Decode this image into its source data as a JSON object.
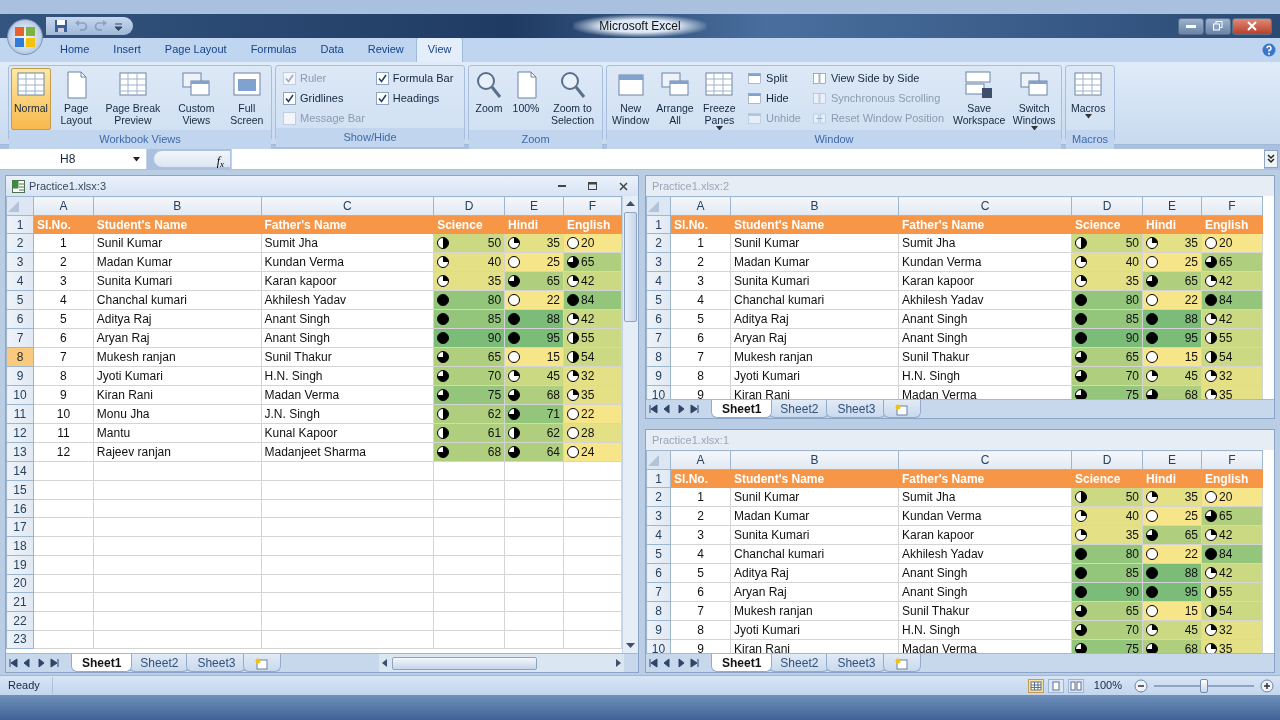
{
  "window": {
    "title": "Microsoft Excel"
  },
  "quick_access": [
    {
      "kind": "save",
      "disabled": false
    },
    {
      "kind": "undo",
      "disabled": true
    },
    {
      "kind": "redo",
      "disabled": true
    },
    {
      "kind": "customize",
      "disabled": false
    }
  ],
  "ribbon_tabs": [
    {
      "label": "Home",
      "selected": false
    },
    {
      "label": "Insert",
      "selected": false
    },
    {
      "label": "Page Layout",
      "selected": false
    },
    {
      "label": "Formulas",
      "selected": false
    },
    {
      "label": "Data",
      "selected": false
    },
    {
      "label": "Review",
      "selected": false
    },
    {
      "label": "View",
      "selected": true
    }
  ],
  "ribbon_groups": [
    {
      "label": "Workbook Views",
      "items": [
        {
          "kind": "large",
          "label": "Normal",
          "selected": true
        },
        {
          "kind": "large",
          "label": "Page Layout",
          "selected": false
        },
        {
          "kind": "large",
          "label": "Page Break Preview",
          "selected": false
        },
        {
          "kind": "large",
          "label": "Custom Views",
          "selected": false
        },
        {
          "kind": "large",
          "label": "Full Screen",
          "selected": false
        }
      ]
    },
    {
      "label": "Show/Hide",
      "items": [
        {
          "kind": "check",
          "label": "Ruler",
          "checked": true,
          "disabled": true
        },
        {
          "kind": "check",
          "label": "Gridlines",
          "checked": true,
          "disabled": false
        },
        {
          "kind": "check",
          "label": "Message Bar",
          "checked": false,
          "disabled": true
        },
        {
          "kind": "check",
          "label": "Formula Bar",
          "checked": true,
          "disabled": false
        },
        {
          "kind": "check",
          "label": "Headings",
          "checked": true,
          "disabled": false
        }
      ]
    },
    {
      "label": "Zoom",
      "items": [
        {
          "kind": "large",
          "label": "Zoom"
        },
        {
          "kind": "large",
          "label": "100%"
        },
        {
          "kind": "large",
          "label": "Zoom to Selection"
        }
      ]
    },
    {
      "label": "Window",
      "items": [
        {
          "kind": "large",
          "label": "New Window"
        },
        {
          "kind": "large",
          "label": "Arrange All"
        },
        {
          "kind": "large",
          "label": "Freeze Panes",
          "dropdown": true
        },
        {
          "kind": "small",
          "label": "Split",
          "disabled": false
        },
        {
          "kind": "small",
          "label": "Hide",
          "disabled": false
        },
        {
          "kind": "small",
          "label": "Unhide",
          "disabled": true
        },
        {
          "kind": "small",
          "label": "View Side by Side",
          "disabled": false
        },
        {
          "kind": "small",
          "label": "Synchronous Scrolling",
          "disabled": true
        },
        {
          "kind": "small",
          "label": "Reset Window Position",
          "disabled": true
        },
        {
          "kind": "large",
          "label": "Save Workspace"
        },
        {
          "kind": "large",
          "label": "Switch Windows",
          "dropdown": true
        }
      ]
    },
    {
      "label": "Macros",
      "items": [
        {
          "kind": "large",
          "label": "Macros",
          "dropdown": true
        }
      ]
    }
  ],
  "formula_bar": {
    "name_box": "H8",
    "function_button": "f$_{x}$"
  },
  "workbooks": [
    {
      "title": "Practice1.xlsx:3",
      "active": true,
      "columns": [
        "A",
        "B",
        "C",
        "D",
        "E",
        "F"
      ],
      "header": {
        "row": "1",
        "cells": [
          "Sl.No.",
          "Student's Name",
          "Father's Name",
          "Science",
          "Hindi",
          "English"
        ]
      },
      "rows": [
        {
          "row": "2",
          "selected": false,
          "cells": [
            "1",
            "Sunil Kumar",
            "Sumit Jha"
          ],
          "scores": [
            {
              "value": "50",
              "kind": "half",
              "color": "#cbd982"
            },
            {
              "value": "35",
              "kind": "quarter",
              "color": "#e3e086"
            },
            {
              "value": "20",
              "kind": "empty",
              "color": "#f7e589"
            }
          ]
        },
        {
          "row": "3",
          "selected": false,
          "cells": [
            "2",
            "Madan Kumar",
            "Kundan Verma"
          ],
          "scores": [
            {
              "value": "40",
              "kind": "quarter",
              "color": "#e3e086"
            },
            {
              "value": "25",
              "kind": "empty",
              "color": "#f7e589"
            },
            {
              "value": "65",
              "kind": "threequarters",
              "color": "#b0cf7e"
            }
          ]
        },
        {
          "row": "4",
          "selected": false,
          "cells": [
            "3",
            "Sunita Kumari",
            "Karan kapoor"
          ],
          "scores": [
            {
              "value": "35",
              "kind": "quarter",
              "color": "#e3e086"
            },
            {
              "value": "65",
              "kind": "threequarters",
              "color": "#b0cf7e"
            },
            {
              "value": "42",
              "kind": "quarter",
              "color": "#cbd982"
            }
          ]
        },
        {
          "row": "5",
          "selected": false,
          "cells": [
            "4",
            "Chanchal kumari",
            "Akhilesh Yadav"
          ],
          "scores": [
            {
              "value": "80",
              "kind": "full",
              "color": "#93c57b"
            },
            {
              "value": "22",
              "kind": "empty",
              "color": "#f7e589"
            },
            {
              "value": "84",
              "kind": "full",
              "color": "#93c57b"
            }
          ]
        },
        {
          "row": "6",
          "selected": false,
          "cells": [
            "5",
            "Aditya Raj",
            "Anant Singh"
          ],
          "scores": [
            {
              "value": "85",
              "kind": "full",
              "color": "#93c57b"
            },
            {
              "value": "88",
              "kind": "full",
              "color": "#7bbd78"
            },
            {
              "value": "42",
              "kind": "quarter",
              "color": "#cbd982"
            }
          ]
        },
        {
          "row": "7",
          "selected": false,
          "cells": [
            "6",
            "Aryan Raj",
            "Anant Singh"
          ],
          "scores": [
            {
              "value": "90",
              "kind": "full",
              "color": "#7bbd78"
            },
            {
              "value": "95",
              "kind": "full",
              "color": "#7bbd78"
            },
            {
              "value": "55",
              "kind": "half",
              "color": "#cbd982"
            }
          ]
        },
        {
          "row": "8",
          "selected": true,
          "cells": [
            "7",
            "Mukesh ranjan",
            "Sunil Thakur"
          ],
          "scores": [
            {
              "value": "65",
              "kind": "threequarters",
              "color": "#b0cf7e"
            },
            {
              "value": "15",
              "kind": "empty",
              "color": "#f7e589"
            },
            {
              "value": "54",
              "kind": "half",
              "color": "#cbd982"
            }
          ]
        },
        {
          "row": "9",
          "selected": false,
          "cells": [
            "8",
            "Jyoti Kumari",
            "H.N. Singh"
          ],
          "scores": [
            {
              "value": "70",
              "kind": "threequarters",
              "color": "#b0cf7e"
            },
            {
              "value": "45",
              "kind": "quarter",
              "color": "#cbd982"
            },
            {
              "value": "32",
              "kind": "quarter",
              "color": "#e3e086"
            }
          ]
        },
        {
          "row": "10",
          "selected": false,
          "cells": [
            "9",
            "Kiran Rani",
            "Madan Verma"
          ],
          "scores": [
            {
              "value": "75",
              "kind": "threequarters",
              "color": "#93c57b"
            },
            {
              "value": "68",
              "kind": "threequarters",
              "color": "#b0cf7e"
            },
            {
              "value": "35",
              "kind": "quarter",
              "color": "#e3e086"
            }
          ]
        },
        {
          "row": "11",
          "selected": false,
          "cells": [
            "10",
            "Monu Jha",
            "J.N. Singh"
          ],
          "scores": [
            {
              "value": "62",
              "kind": "half",
              "color": "#b0cf7e"
            },
            {
              "value": "71",
              "kind": "threequarters",
              "color": "#93c57b"
            },
            {
              "value": "22",
              "kind": "empty",
              "color": "#f7e589"
            }
          ]
        },
        {
          "row": "12",
          "selected": false,
          "cells": [
            "11",
            "Mantu",
            "Kunal Kapoor"
          ],
          "scores": [
            {
              "value": "61",
              "kind": "half",
              "color": "#b0cf7e"
            },
            {
              "value": "62",
              "kind": "half",
              "color": "#b0cf7e"
            },
            {
              "value": "28",
              "kind": "empty",
              "color": "#e3e086"
            }
          ]
        },
        {
          "row": "13",
          "selected": false,
          "cells": [
            "12",
            "Rajeev ranjan",
            "Madanjeet Sharma"
          ],
          "scores": [
            {
              "value": "68",
              "kind": "threequarters",
              "color": "#b0cf7e"
            },
            {
              "value": "64",
              "kind": "threequarters",
              "color": "#b0cf7e"
            },
            {
              "value": "24",
              "kind": "empty",
              "color": "#f7e589"
            }
          ]
        }
      ],
      "empty_rows": [
        "14",
        "15",
        "16",
        "17",
        "18",
        "19",
        "20",
        "21",
        "22",
        "23"
      ],
      "sheets": [
        {
          "label": "Sheet1",
          "selected": true
        },
        {
          "label": "Sheet2",
          "selected": false
        },
        {
          "label": "Sheet3",
          "selected": false
        }
      ]
    },
    {
      "title": "Practice1.xlsx:2",
      "active": false,
      "columns": [
        "A",
        "B",
        "C",
        "D",
        "E",
        "F"
      ],
      "header": {
        "row": "1",
        "cells": [
          "Sl.No.",
          "Student's Name",
          "Father's Name",
          "Science",
          "Hindi",
          "English"
        ]
      },
      "rows": [
        {
          "row": "2",
          "selected": false,
          "cells": [
            "1",
            "Sunil Kumar",
            "Sumit Jha"
          ],
          "scores": [
            {
              "value": "50",
              "kind": "half",
              "color": "#cbd982"
            },
            {
              "value": "35",
              "kind": "quarter",
              "color": "#e3e086"
            },
            {
              "value": "20",
              "kind": "empty",
              "color": "#f7e589"
            }
          ]
        },
        {
          "row": "3",
          "selected": false,
          "cells": [
            "2",
            "Madan Kumar",
            "Kundan Verma"
          ],
          "scores": [
            {
              "value": "40",
              "kind": "quarter",
              "color": "#e3e086"
            },
            {
              "value": "25",
              "kind": "empty",
              "color": "#f7e589"
            },
            {
              "value": "65",
              "kind": "threequarters",
              "color": "#b0cf7e"
            }
          ]
        },
        {
          "row": "4",
          "selected": false,
          "cells": [
            "3",
            "Sunita Kumari",
            "Karan kapoor"
          ],
          "scores": [
            {
              "value": "35",
              "kind": "quarter",
              "color": "#e3e086"
            },
            {
              "value": "65",
              "kind": "threequarters",
              "color": "#b0cf7e"
            },
            {
              "value": "42",
              "kind": "quarter",
              "color": "#cbd982"
            }
          ]
        },
        {
          "row": "5",
          "selected": false,
          "cells": [
            "4",
            "Chanchal kumari",
            "Akhilesh Yadav"
          ],
          "scores": [
            {
              "value": "80",
              "kind": "full",
              "color": "#93c57b"
            },
            {
              "value": "22",
              "kind": "empty",
              "color": "#f7e589"
            },
            {
              "value": "84",
              "kind": "full",
              "color": "#93c57b"
            }
          ]
        },
        {
          "row": "6",
          "selected": false,
          "cells": [
            "5",
            "Aditya Raj",
            "Anant Singh"
          ],
          "scores": [
            {
              "value": "85",
              "kind": "full",
              "color": "#93c57b"
            },
            {
              "value": "88",
              "kind": "full",
              "color": "#7bbd78"
            },
            {
              "value": "42",
              "kind": "quarter",
              "color": "#cbd982"
            }
          ]
        },
        {
          "row": "7",
          "selected": false,
          "cells": [
            "6",
            "Aryan Raj",
            "Anant Singh"
          ],
          "scores": [
            {
              "value": "90",
              "kind": "full",
              "color": "#7bbd78"
            },
            {
              "value": "95",
              "kind": "full",
              "color": "#7bbd78"
            },
            {
              "value": "55",
              "kind": "half",
              "color": "#cbd982"
            }
          ]
        },
        {
          "row": "8",
          "selected": false,
          "cells": [
            "7",
            "Mukesh ranjan",
            "Sunil Thakur"
          ],
          "scores": [
            {
              "value": "65",
              "kind": "threequarters",
              "color": "#b0cf7e"
            },
            {
              "value": "15",
              "kind": "empty",
              "color": "#f7e589"
            },
            {
              "value": "54",
              "kind": "half",
              "color": "#cbd982"
            }
          ]
        },
        {
          "row": "9",
          "selected": false,
          "cells": [
            "8",
            "Jyoti Kumari",
            "H.N. Singh"
          ],
          "scores": [
            {
              "value": "70",
              "kind": "threequarters",
              "color": "#b0cf7e"
            },
            {
              "value": "45",
              "kind": "quarter",
              "color": "#cbd982"
            },
            {
              "value": "32",
              "kind": "quarter",
              "color": "#e3e086"
            }
          ]
        },
        {
          "row": "10",
          "selected": false,
          "cells": [
            "9",
            "Kiran Rani",
            "Madan Verma"
          ],
          "scores": [
            {
              "value": "75",
              "kind": "threequarters",
              "color": "#93c57b"
            },
            {
              "value": "68",
              "kind": "threequarters",
              "color": "#b0cf7e"
            },
            {
              "value": "35",
              "kind": "quarter",
              "color": "#e3e086"
            }
          ]
        }
      ],
      "sheets": [
        {
          "label": "Sheet1",
          "selected": true
        },
        {
          "label": "Sheet2",
          "selected": false
        },
        {
          "label": "Sheet3",
          "selected": false
        }
      ]
    },
    {
      "title": "Practice1.xlsx:1",
      "active": false,
      "columns": [
        "A",
        "B",
        "C",
        "D",
        "E",
        "F"
      ],
      "header": {
        "row": "1",
        "cells": [
          "Sl.No.",
          "Student's Name",
          "Father's Name",
          "Science",
          "Hindi",
          "English"
        ]
      },
      "rows": [
        {
          "row": "2",
          "selected": false,
          "cells": [
            "1",
            "Sunil Kumar",
            "Sumit Jha"
          ],
          "scores": [
            {
              "value": "50",
              "kind": "half",
              "color": "#cbd982"
            },
            {
              "value": "35",
              "kind": "quarter",
              "color": "#e3e086"
            },
            {
              "value": "20",
              "kind": "empty",
              "color": "#f7e589"
            }
          ]
        },
        {
          "row": "3",
          "selected": false,
          "cells": [
            "2",
            "Madan Kumar",
            "Kundan Verma"
          ],
          "scores": [
            {
              "value": "40",
              "kind": "quarter",
              "color": "#e3e086"
            },
            {
              "value": "25",
              "kind": "empty",
              "color": "#f7e589"
            },
            {
              "value": "65",
              "kind": "threequarters",
              "color": "#b0cf7e"
            }
          ]
        },
        {
          "row": "4",
          "selected": false,
          "cells": [
            "3",
            "Sunita Kumari",
            "Karan kapoor"
          ],
          "scores": [
            {
              "value": "35",
              "kind": "quarter",
              "color": "#e3e086"
            },
            {
              "value": "65",
              "kind": "threequarters",
              "color": "#b0cf7e"
            },
            {
              "value": "42",
              "kind": "quarter",
              "color": "#cbd982"
            }
          ]
        },
        {
          "row": "5",
          "selected": false,
          "cells": [
            "4",
            "Chanchal kumari",
            "Akhilesh Yadav"
          ],
          "scores": [
            {
              "value": "80",
              "kind": "full",
              "color": "#93c57b"
            },
            {
              "value": "22",
              "kind": "empty",
              "color": "#f7e589"
            },
            {
              "value": "84",
              "kind": "full",
              "color": "#93c57b"
            }
          ]
        },
        {
          "row": "6",
          "selected": false,
          "cells": [
            "5",
            "Aditya Raj",
            "Anant Singh"
          ],
          "scores": [
            {
              "value": "85",
              "kind": "full",
              "color": "#93c57b"
            },
            {
              "value": "88",
              "kind": "full",
              "color": "#7bbd78"
            },
            {
              "value": "42",
              "kind": "quarter",
              "color": "#cbd982"
            }
          ]
        },
        {
          "row": "7",
          "selected": false,
          "cells": [
            "6",
            "Aryan Raj",
            "Anant Singh"
          ],
          "scores": [
            {
              "value": "90",
              "kind": "full",
              "color": "#7bbd78"
            },
            {
              "value": "95",
              "kind": "full",
              "color": "#7bbd78"
            },
            {
              "value": "55",
              "kind": "half",
              "color": "#cbd982"
            }
          ]
        },
        {
          "row": "8",
          "selected": false,
          "cells": [
            "7",
            "Mukesh ranjan",
            "Sunil Thakur"
          ],
          "scores": [
            {
              "value": "65",
              "kind": "threequarters",
              "color": "#b0cf7e"
            },
            {
              "value": "15",
              "kind": "empty",
              "color": "#f7e589"
            },
            {
              "value": "54",
              "kind": "half",
              "color": "#cbd982"
            }
          ]
        },
        {
          "row": "9",
          "selected": false,
          "cells": [
            "8",
            "Jyoti Kumari",
            "H.N. Singh"
          ],
          "scores": [
            {
              "value": "70",
              "kind": "threequarters",
              "color": "#b0cf7e"
            },
            {
              "value": "45",
              "kind": "quarter",
              "color": "#cbd982"
            },
            {
              "value": "32",
              "kind": "quarter",
              "color": "#e3e086"
            }
          ]
        },
        {
          "row": "10",
          "selected": false,
          "cells": [
            "9",
            "Kiran Rani",
            "Madan Verma"
          ],
          "scores": [
            {
              "value": "75",
              "kind": "threequarters",
              "color": "#93c57b"
            },
            {
              "value": "68",
              "kind": "threequarters",
              "color": "#b0cf7e"
            },
            {
              "value": "35",
              "kind": "quarter",
              "color": "#e3e086"
            }
          ]
        }
      ],
      "sheets": [
        {
          "label": "Sheet1",
          "selected": true
        },
        {
          "label": "Sheet2",
          "selected": false
        },
        {
          "label": "Sheet3",
          "selected": false
        }
      ]
    }
  ],
  "status_bar": {
    "text": "Ready",
    "views": [
      {
        "selected": true
      },
      {
        "selected": false
      },
      {
        "selected": false
      }
    ],
    "zoom": "100%",
    "zoom_slider": {
      "level": 0.5
    }
  }
}
